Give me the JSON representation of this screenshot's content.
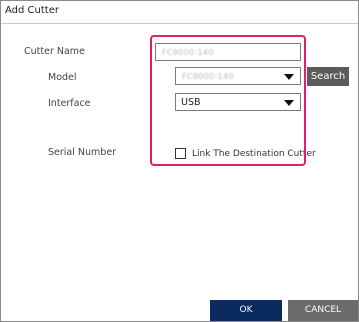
{
  "window": {
    "title": "Add Cutter"
  },
  "form": {
    "cutter_name": {
      "label": "Cutter Name",
      "value": "FC9000-140"
    },
    "model": {
      "label": "Model",
      "value": "FC9000-140"
    },
    "interface": {
      "label": "Interface",
      "value": "USB"
    },
    "link_destination": {
      "label": "Link The Destination Cutter",
      "checked": false
    },
    "serial_number": {
      "label": "Serial Number"
    }
  },
  "buttons": {
    "search": "Search",
    "ok": "OK",
    "cancel": "CANCEL"
  },
  "colors": {
    "highlight": "#e0206a",
    "ok_button": "#0b2a5e",
    "cancel_button": "#6b6b6b",
    "search_button": "#5b5b5b"
  }
}
